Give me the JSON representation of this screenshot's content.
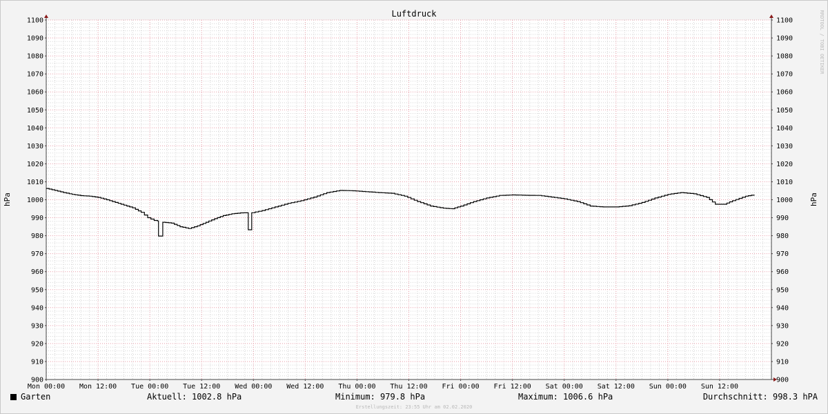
{
  "chart_data": {
    "type": "line",
    "title": "Luftdruck",
    "ylabel": "hPa",
    "ylim": [
      900,
      1100
    ],
    "y_major_step": 10,
    "y_minor_step": 2,
    "x_unit": "hours since Mon 00:00",
    "xlim": [
      0,
      168
    ],
    "x_ticks": [
      {
        "label": "Mon 00:00",
        "x": 0
      },
      {
        "label": "Mon 12:00",
        "x": 12
      },
      {
        "label": "Tue 00:00",
        "x": 24
      },
      {
        "label": "Tue 12:00",
        "x": 36
      },
      {
        "label": "Wed 00:00",
        "x": 48
      },
      {
        "label": "Wed 12:00",
        "x": 60
      },
      {
        "label": "Thu 00:00",
        "x": 72
      },
      {
        "label": "Thu 12:00",
        "x": 84
      },
      {
        "label": "Fri 00:00",
        "x": 96
      },
      {
        "label": "Fri 12:00",
        "x": 108
      },
      {
        "label": "Sat 00:00",
        "x": 120
      },
      {
        "label": "Sat 12:00",
        "x": 132
      },
      {
        "label": "Sun 00:00",
        "x": 144
      },
      {
        "label": "Sun 12:00",
        "x": 156
      }
    ],
    "grid": true,
    "series": [
      {
        "name": "Garten",
        "color": "#000000",
        "points": [
          [
            0,
            1006.3
          ],
          [
            2,
            1005.2
          ],
          [
            4,
            1004.0
          ],
          [
            6,
            1003.0
          ],
          [
            8,
            1002.3
          ],
          [
            10,
            1002.0
          ],
          [
            12,
            1001.3
          ],
          [
            14,
            1000.0
          ],
          [
            16,
            998.5
          ],
          [
            18,
            997.0
          ],
          [
            20,
            995.5
          ],
          [
            22,
            993.0
          ],
          [
            23.5,
            990.0
          ],
          [
            25,
            988.5
          ],
          [
            25.8,
            988.2
          ],
          [
            26.0,
            979.8
          ],
          [
            26.8,
            979.8
          ],
          [
            27.0,
            987.5
          ],
          [
            29,
            987.0
          ],
          [
            31,
            985.0
          ],
          [
            33,
            984.0
          ],
          [
            35,
            985.5
          ],
          [
            37,
            987.5
          ],
          [
            39,
            989.5
          ],
          [
            41,
            991.2
          ],
          [
            43,
            992.2
          ],
          [
            45,
            992.7
          ],
          [
            46.6,
            992.8
          ],
          [
            46.8,
            983.3
          ],
          [
            47.5,
            983.3
          ],
          [
            47.6,
            992.8
          ],
          [
            50,
            994.0
          ],
          [
            53,
            996.0
          ],
          [
            56,
            998.0
          ],
          [
            59,
            999.5
          ],
          [
            62,
            1001.5
          ],
          [
            65,
            1004.0
          ],
          [
            68,
            1005.2
          ],
          [
            71,
            1005.0
          ],
          [
            74,
            1004.5
          ],
          [
            77,
            1004.0
          ],
          [
            80,
            1003.6
          ],
          [
            83,
            1002.0
          ],
          [
            86,
            999.0
          ],
          [
            89,
            996.5
          ],
          [
            92,
            995.3
          ],
          [
            94,
            995.0
          ],
          [
            96,
            996.5
          ],
          [
            99,
            999.0
          ],
          [
            102,
            1001.0
          ],
          [
            105,
            1002.4
          ],
          [
            108,
            1002.7
          ],
          [
            111,
            1002.5
          ],
          [
            114,
            1002.4
          ],
          [
            117,
            1001.5
          ],
          [
            120,
            1000.5
          ],
          [
            123,
            999.0
          ],
          [
            126,
            996.5
          ],
          [
            129,
            996.0
          ],
          [
            132,
            996.0
          ],
          [
            135,
            996.7
          ],
          [
            138,
            998.5
          ],
          [
            141,
            1001.0
          ],
          [
            144,
            1003.0
          ],
          [
            147,
            1004.0
          ],
          [
            150,
            1003.3
          ],
          [
            153,
            1001.3
          ],
          [
            155,
            997.5
          ],
          [
            157,
            997.5
          ],
          [
            159,
            999.5
          ],
          [
            162,
            1002.0
          ],
          [
            164,
            1002.8
          ]
        ]
      }
    ]
  },
  "legend": {
    "swatch_color": "#000000",
    "label": "Garten"
  },
  "stats": {
    "current": "Aktuell: 1002.8 hPa",
    "minimum": "Minimum: 979.8 hPa",
    "maximum": "Maximum: 1006.6 hPa",
    "average": "Durchschnitt: 998.3 hPA"
  },
  "footer": {
    "created": "Erstellungszeit: 23:55 Uhr am 02.02.2020"
  },
  "watermark": "RRDTOOL / TOBI OETIKER",
  "colors": {
    "canvas_bg": "#ffffff",
    "frame_bg": "#f3f3f3",
    "major_grid": "#e89aa6",
    "minor_grid": "#d4d4d4",
    "axis": "#444444",
    "arrow": "#8b1a1a"
  }
}
